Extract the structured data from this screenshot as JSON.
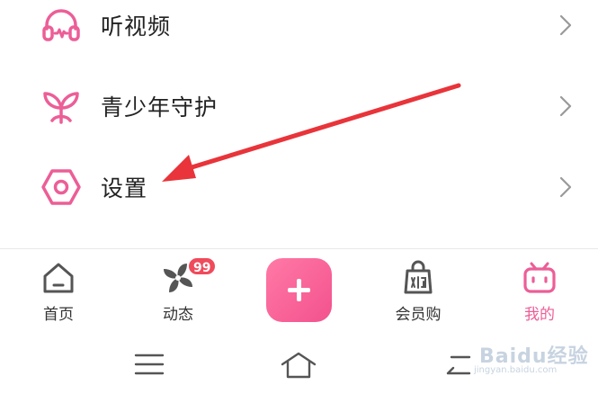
{
  "menu": {
    "items": [
      {
        "label": "听视频",
        "icon": "headphones-icon"
      },
      {
        "label": "青少年守护",
        "icon": "sprout-icon"
      },
      {
        "label": "设置",
        "icon": "settings-hexagon-icon"
      }
    ]
  },
  "tabbar": {
    "tabs": [
      {
        "label": "首页",
        "icon": "home-icon"
      },
      {
        "label": "动态",
        "icon": "pinwheel-icon",
        "badge": "99"
      },
      {
        "label": "会员购",
        "icon": "shopping-bag-icon"
      },
      {
        "label": "我的",
        "icon": "tv-icon",
        "active": true
      }
    ],
    "add_button_icon": "plus-icon"
  },
  "system_nav": {
    "icons": [
      "menu-lines-icon",
      "home-outline-icon",
      "back-icon"
    ]
  },
  "colors": {
    "accent": "#ec5e97",
    "badge": "#f04a5b",
    "arrow": "#e8343a"
  },
  "watermark": {
    "text": "Baidu经验",
    "url": "jingyan.baidu.com"
  }
}
